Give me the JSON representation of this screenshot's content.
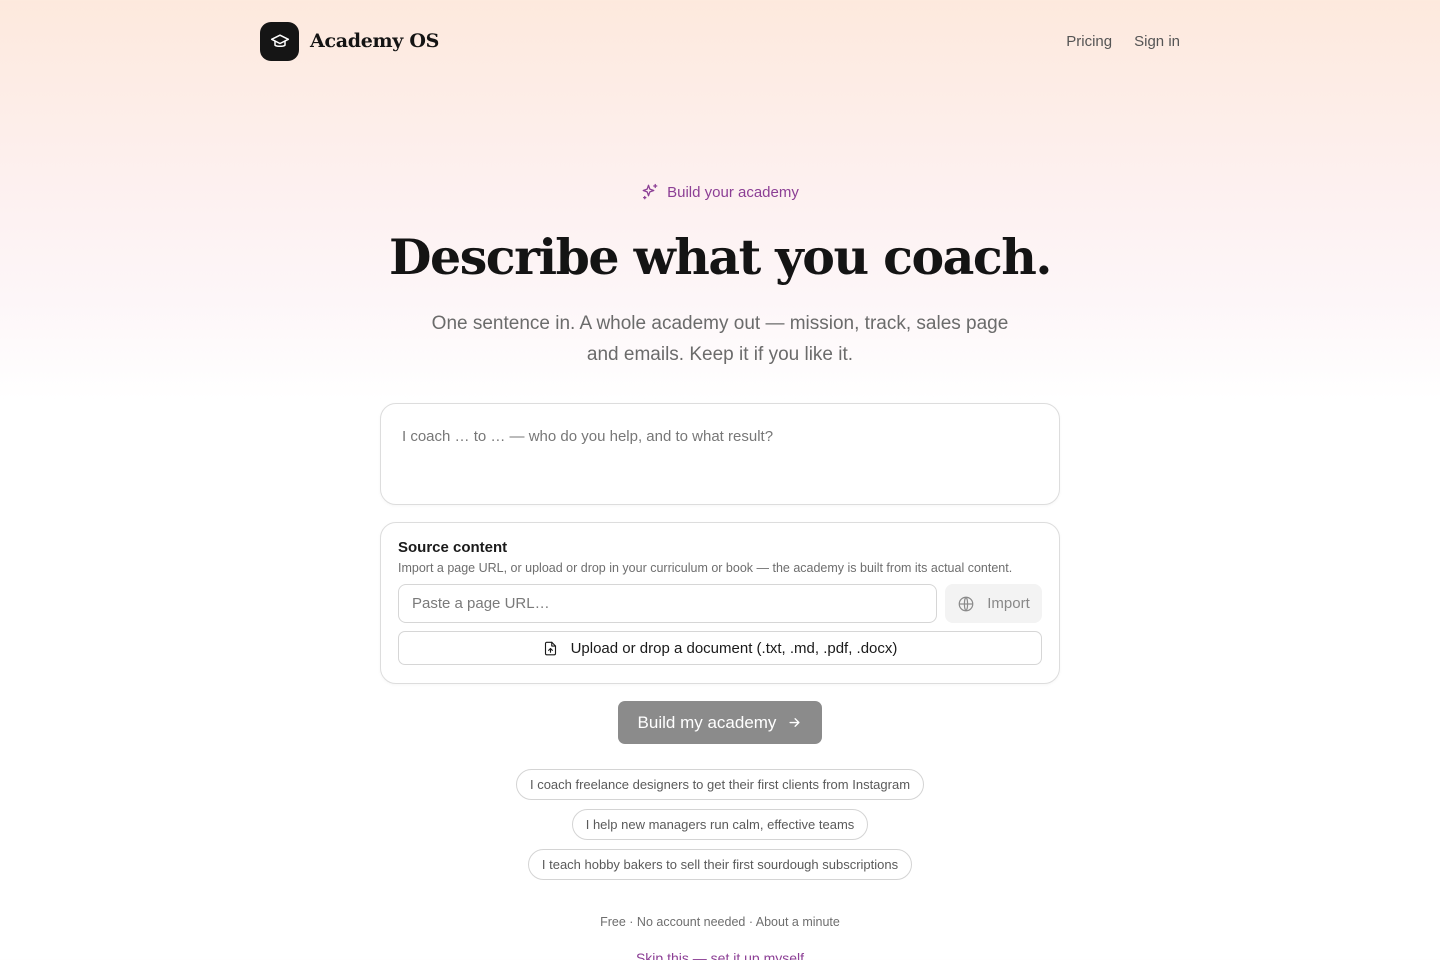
{
  "header": {
    "brand_name": "Academy OS",
    "logo_icon": "graduation-cap-icon",
    "nav": [
      {
        "label": "Pricing"
      },
      {
        "label": "Sign in"
      }
    ]
  },
  "hero": {
    "eyebrow": "Build your academy",
    "eyebrow_icon": "sparkles-icon",
    "title": "Describe what you coach.",
    "subtitle": "One sentence in. A whole academy out — mission, track, sales page and emails. Keep it if you like it."
  },
  "coach_input": {
    "placeholder": "I coach … to … — who do you help, and to what result?",
    "value": ""
  },
  "source_content": {
    "title": "Source content",
    "description": "Import a page URL, or upload or drop in your curriculum or book — the academy is built from its actual content.",
    "url_placeholder": "Paste a page URL…",
    "url_value": "",
    "import_label": "Import",
    "import_icon": "globe-icon",
    "upload_label": "Upload or drop a document (.txt, .md, .pdf, .docx)",
    "upload_icon": "file-upload-icon"
  },
  "primary_action": {
    "label": "Build my academy",
    "icon": "arrow-right-icon"
  },
  "examples": [
    {
      "label": "I coach freelance designers to get their first clients from Instagram"
    },
    {
      "label": "I help new managers run calm, effective teams"
    },
    {
      "label": "I teach hobby bakers to sell their first sourdough subscriptions"
    }
  ],
  "footnote": "Free · No account needed · About a minute",
  "skip_link": "Skip this — set it up myself",
  "colors": {
    "accent": "#8c3f95",
    "button_disabled": "#8b8b8b",
    "logo_bg": "#151515"
  }
}
